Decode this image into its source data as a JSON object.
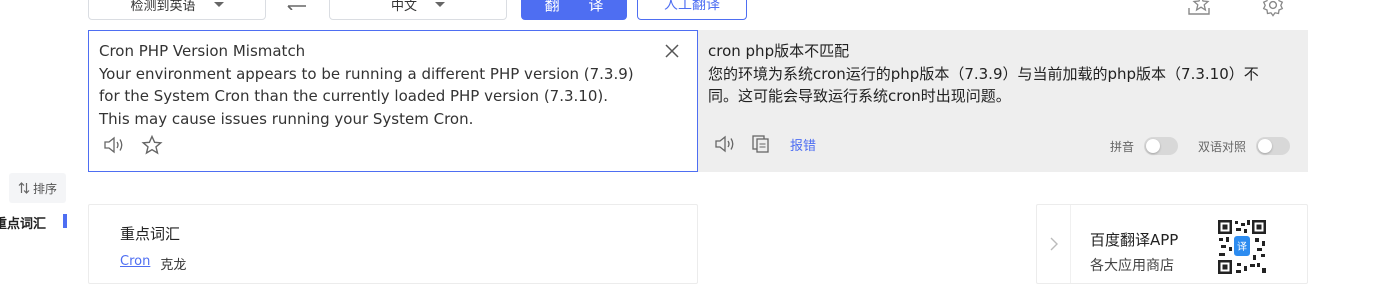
{
  "toolbar": {
    "source_lang": "检测到英语",
    "target_lang": "中文",
    "translate_label": "翻 译",
    "human_translate_label": "人工翻译"
  },
  "source": {
    "title": "Cron PHP Version Mismatch",
    "body": "Your environment appears to be running a different PHP version (7.3.9) for the System Cron than the currently loaded PHP version (7.3.10). This may cause issues running your System Cron."
  },
  "target": {
    "line1": "cron php版本不匹配",
    "body": "您的环境为系统cron运行的php版本（7.3.9）与当前加载的php版本（7.3.10）不同。这可能会导致运行系统cron时出现问题。",
    "report_label": "报错",
    "pinyin_label": "拼音",
    "pinyin_on": false,
    "bilingual_label": "双语对照",
    "bilingual_on": false
  },
  "sidebar": {
    "sort_label": "排序",
    "keywords_nav_label": "重点词汇"
  },
  "keywords": {
    "title": "重点词汇",
    "items": [
      {
        "word": "Cron",
        "meaning": "克龙"
      }
    ]
  },
  "promo": {
    "title": "百度翻译APP",
    "subtitle": "各大应用商店"
  },
  "colors": {
    "accent": "#4e6ef2",
    "target_bg": "#eeeeee"
  },
  "icons": [
    "chevron-down-icon",
    "swap-icon",
    "favorite-star-icon",
    "settings-gear-icon",
    "close-icon",
    "speaker-icon",
    "star-icon",
    "copy-icon",
    "sort-icon",
    "chevron-right-icon",
    "qr-code-icon"
  ]
}
